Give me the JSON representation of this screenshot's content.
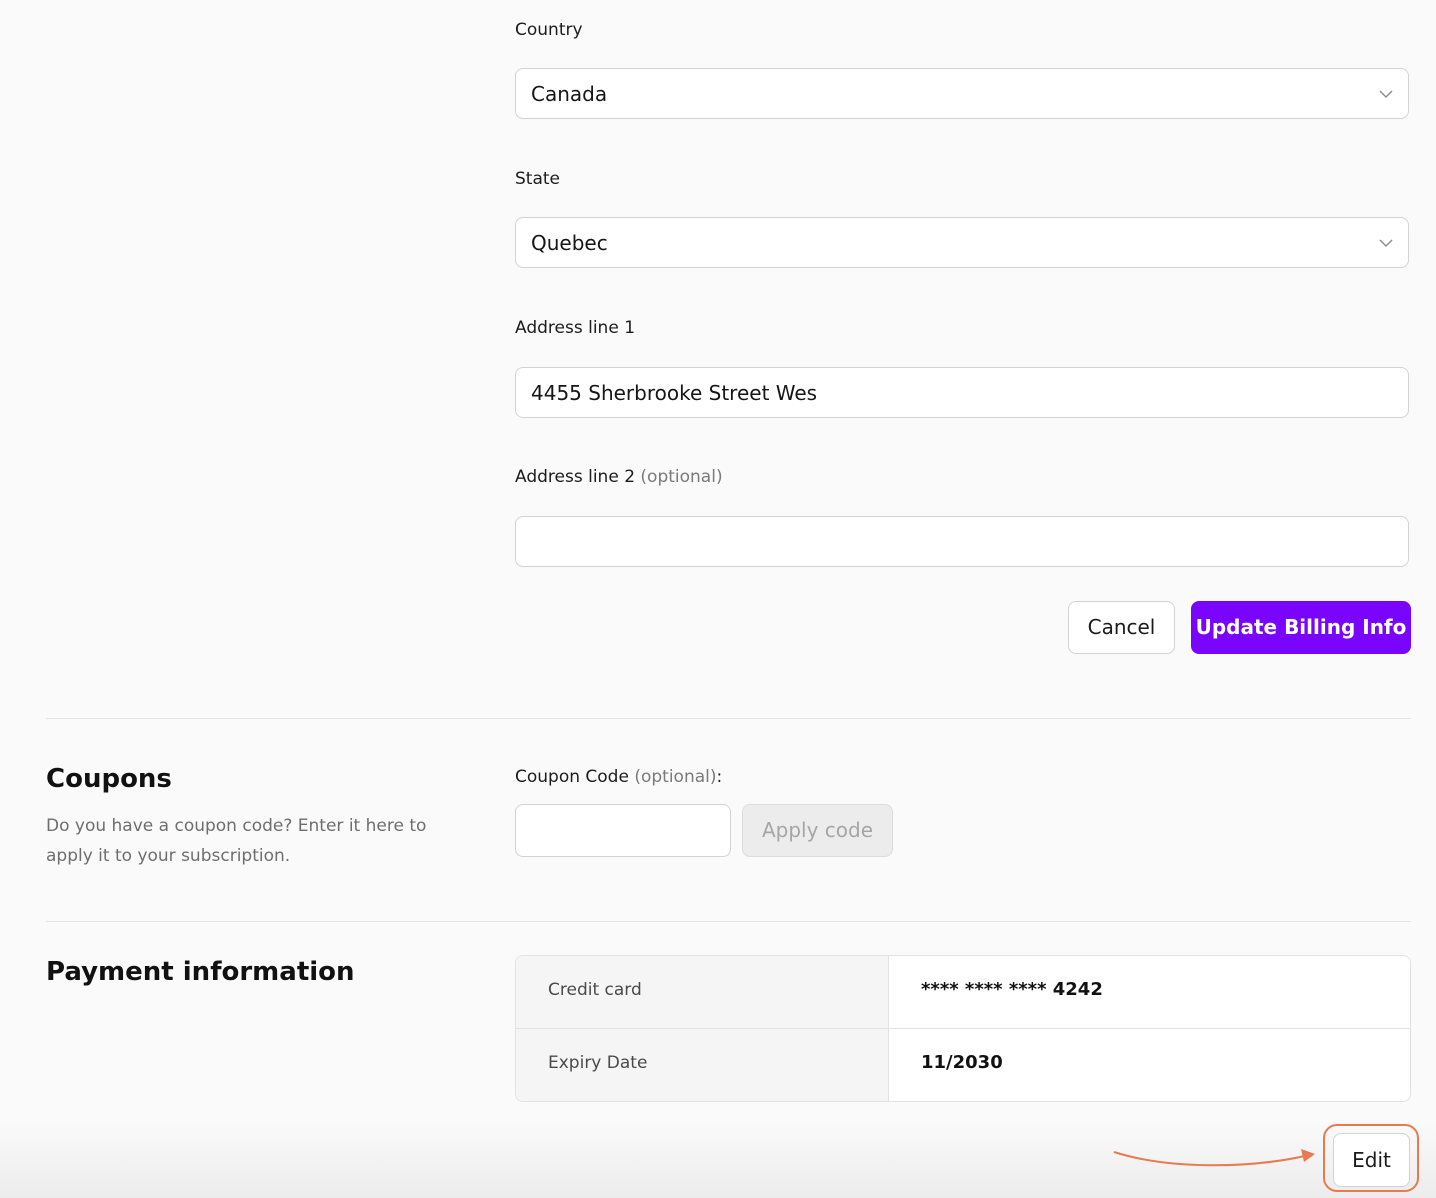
{
  "billing": {
    "country": {
      "label": "Country",
      "value": "Canada"
    },
    "state": {
      "label": "State",
      "value": "Quebec"
    },
    "address1": {
      "label": "Address line 1",
      "value": "4455 Sherbrooke Street Wes"
    },
    "address2": {
      "label": "Address line 2",
      "optional": "(optional)",
      "value": ""
    },
    "cancel_label": "Cancel",
    "update_label": "Update Billing Info"
  },
  "coupons": {
    "title": "Coupons",
    "description": "Do you have a coupon code? Enter it here to apply it to your subscription.",
    "label": "Coupon Code",
    "optional": "(optional)",
    "colon": ":",
    "input_value": "",
    "apply_label": "Apply code"
  },
  "payment": {
    "title": "Payment information",
    "rows": [
      {
        "key": "Credit card",
        "value": "**** **** **** 4242"
      },
      {
        "key": "Expiry Date",
        "value": "11/2030"
      }
    ],
    "edit_label": "Edit"
  },
  "colors": {
    "primary": "#7a05ff",
    "highlight": "#e87a4f"
  },
  "icons": {
    "select_chevron": "chevron-down-icon",
    "annotation_arrow": "arrow-icon"
  }
}
